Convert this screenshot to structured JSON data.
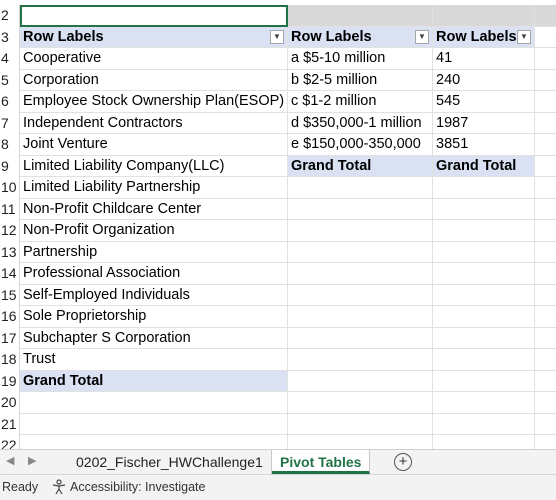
{
  "sheet": {
    "row_numbers": [
      "2",
      "3",
      "4",
      "5",
      "6",
      "7",
      "8",
      "9",
      "10",
      "11",
      "12",
      "13",
      "14",
      "15",
      "16",
      "17",
      "18",
      "19",
      "20",
      "21",
      "22"
    ],
    "pivot1": {
      "header": "Row Labels",
      "items": [
        "Cooperative",
        "Corporation",
        "Employee Stock Ownership Plan(ESOP)",
        "Independent Contractors",
        "Joint Venture",
        "Limited  Liability Company(LLC)",
        "Limited Liability Partnership",
        "Non-Profit Childcare Center",
        "Non-Profit Organization",
        "Partnership",
        "Professional Association",
        "Self-Employed Individuals",
        "Sole Proprietorship",
        "Subchapter S Corporation",
        "Trust"
      ],
      "grand_total": "Grand Total"
    },
    "pivot2": {
      "header": "Row Labels",
      "items": [
        "a $5-10 million",
        "b $2-5 million",
        "c $1-2 million",
        "d $350,000-1 million",
        "e $150,000-350,000"
      ],
      "grand_total": "Grand Total"
    },
    "pivot3": {
      "header": "Row Labels",
      "items": [
        "41",
        "240",
        "545",
        "1987",
        "3851"
      ],
      "grand_total": "Grand Total"
    }
  },
  "tabs": {
    "sheets": [
      "0202_Fischer_HWChallenge1",
      "Pivot Tables"
    ],
    "active_index": 1,
    "add_icon": "plus-circle-icon",
    "nav_icons": [
      "chevron-left-icon",
      "chevron-right-icon"
    ]
  },
  "status": {
    "ready": "Ready",
    "accessibility": "Accessibility: Investigate",
    "accessibility_icon": "accessibility-person-icon"
  },
  "colors": {
    "pivot_header": "#d9e1f2",
    "selection_border": "#217346",
    "active_tab_text": "#217346"
  }
}
